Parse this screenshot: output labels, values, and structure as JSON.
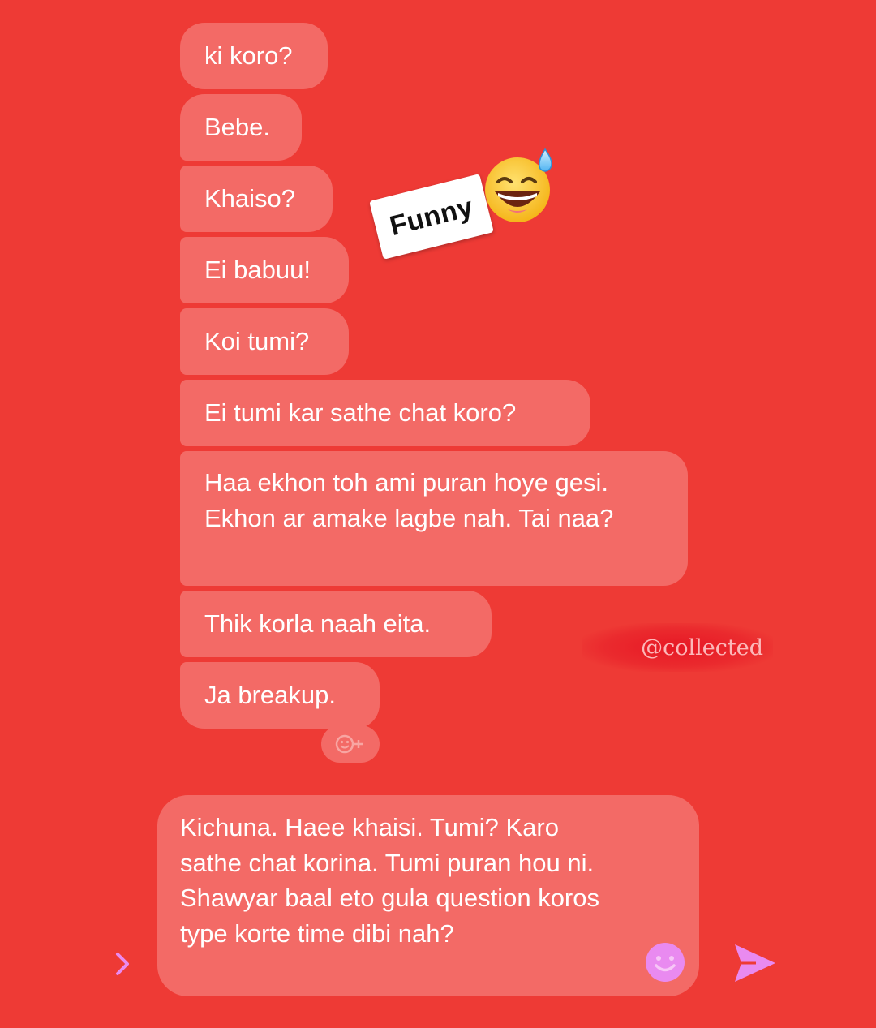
{
  "messages": [
    {
      "text": "ki koro?"
    },
    {
      "text": "Bebe."
    },
    {
      "text": "Khaiso?"
    },
    {
      "text": "Ei babuu!"
    },
    {
      "text": "Koi tumi?"
    },
    {
      "text": "Ei tumi kar sathe chat koro?"
    },
    {
      "text": "Haa ekhon toh ami puran hoye gesi. Ekhon ar amake lagbe nah. Tai naa?"
    },
    {
      "text": "Thik korla naah eita."
    },
    {
      "text": "Ja breakup."
    }
  ],
  "reaction": {
    "icon": "add-reaction-icon"
  },
  "sticker": {
    "label": "Funny",
    "emoji": "grinning-sweat-emoji"
  },
  "watermark": {
    "text": "@collected"
  },
  "composer": {
    "text": "Kichuna. Haee khaisi. Tumi? Karo sathe chat korina. Tumi puran hou ni. Shawyar baal eto gula question koros type korte time dibi nah?",
    "emoji_icon": "smiley-icon",
    "send_icon": "send-icon",
    "expand_icon": "chevron-right-icon"
  },
  "colors": {
    "background": "#EE3A35",
    "bubble": "#F36A66",
    "text": "#FFFFFF",
    "accent": "#E98AF0"
  }
}
